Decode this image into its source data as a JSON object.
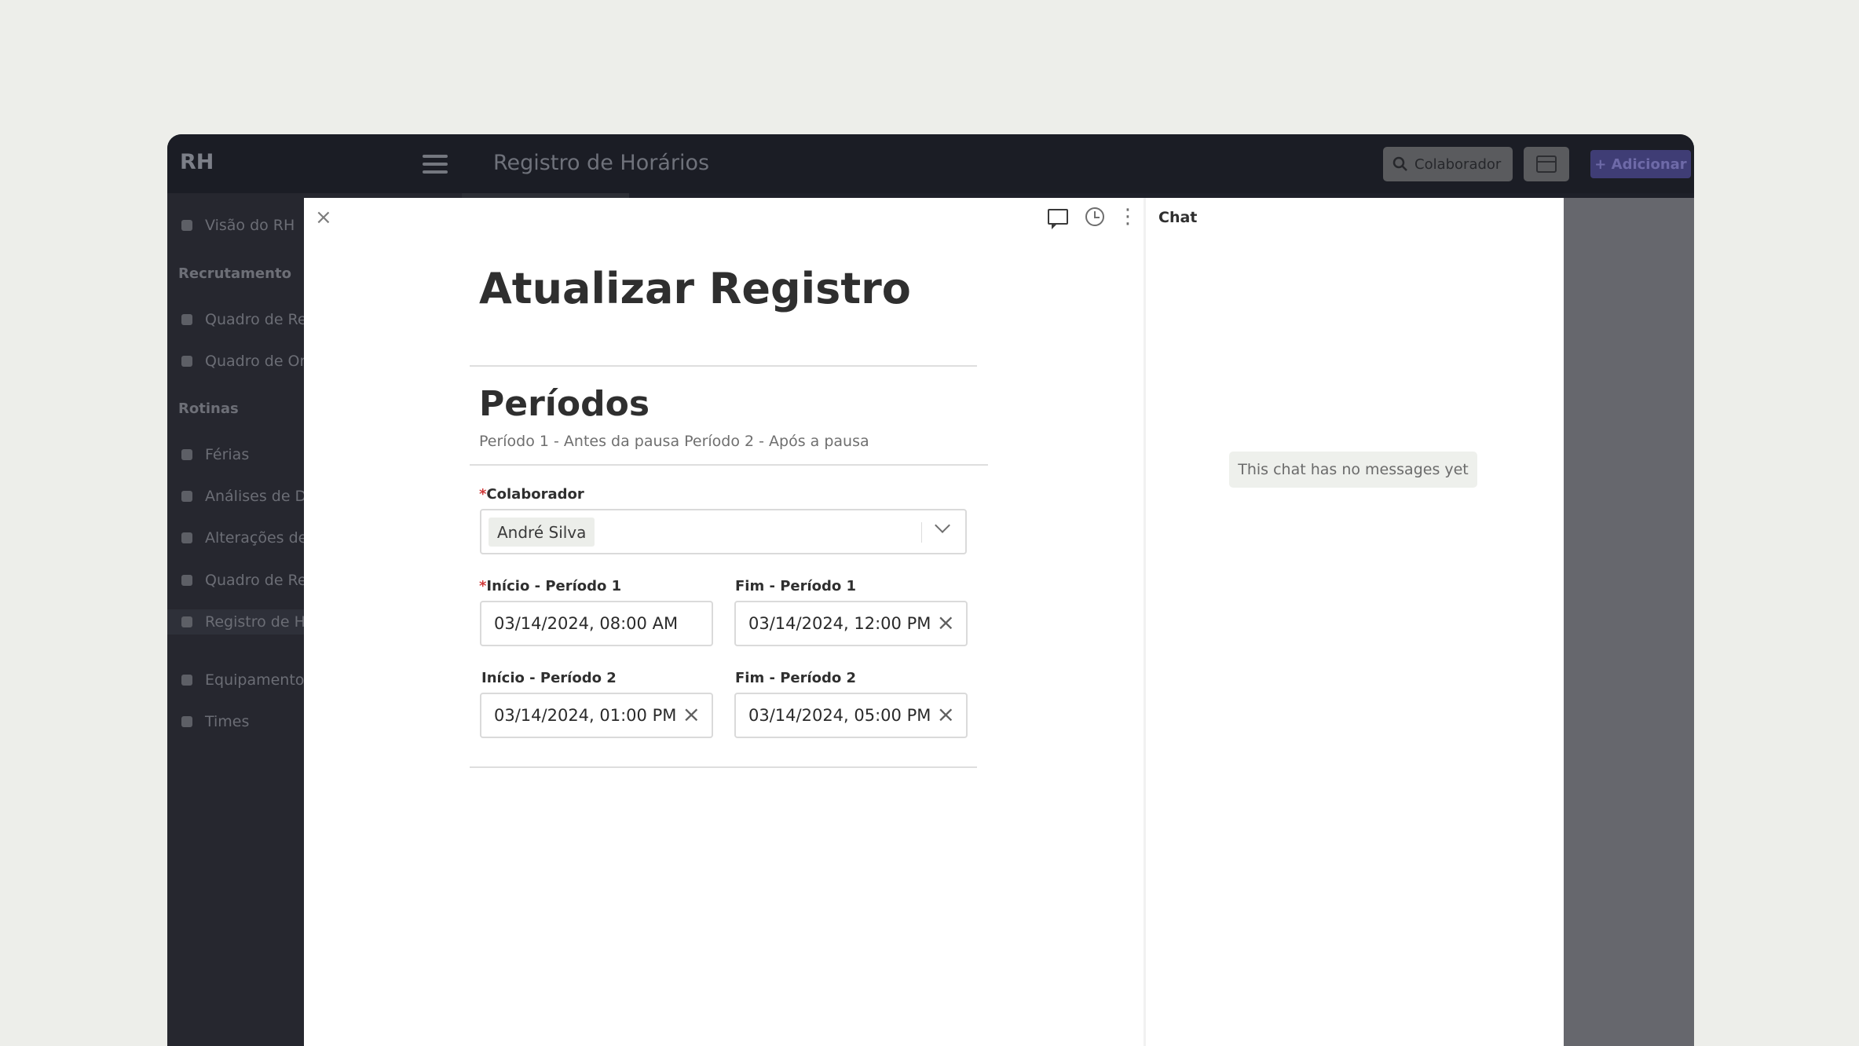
{
  "app": {
    "brand": "RH",
    "title": "Registro de Horários"
  },
  "topbar": {
    "search_label": "Colaborador",
    "add_label": "+ Adicionar"
  },
  "sidebar": {
    "items": [
      {
        "label": "Visão do RH"
      },
      {
        "section": "Recrutamento"
      },
      {
        "label": "Quadro de Re"
      },
      {
        "label": "Quadro de Or"
      },
      {
        "section": "Rotinas"
      },
      {
        "label": "Férias"
      },
      {
        "label": "Análises de D"
      },
      {
        "label": "Alterações de"
      },
      {
        "label": "Quadro de Re"
      },
      {
        "label": "Registro de H"
      },
      {
        "label": "Equipamentos"
      },
      {
        "label": "Times"
      }
    ]
  },
  "modal": {
    "close": "×",
    "dots": "⋮",
    "title": "Atualizar Registro",
    "section_title": "Períodos",
    "section_subtitle": "Período 1 - Antes da pausa Período 2 - Após a pausa",
    "fields": {
      "colaborador": {
        "label": "Colaborador",
        "value": "André Silva"
      },
      "inicio1": {
        "label": "Início - Período 1",
        "value": "03/14/2024, 08:00 AM"
      },
      "fim1": {
        "label": "Fim - Período 1",
        "value": "03/14/2024, 12:00 PM"
      },
      "inicio2": {
        "label": "Início - Período 2",
        "value": "03/14/2024, 01:00 PM"
      },
      "fim2": {
        "label": "Fim - Período 2",
        "value": "03/14/2024, 05:00 PM"
      }
    },
    "required_mark": "*",
    "clear_glyph": "×"
  },
  "chat": {
    "title": "Chat",
    "empty": "This chat has no messages yet"
  }
}
